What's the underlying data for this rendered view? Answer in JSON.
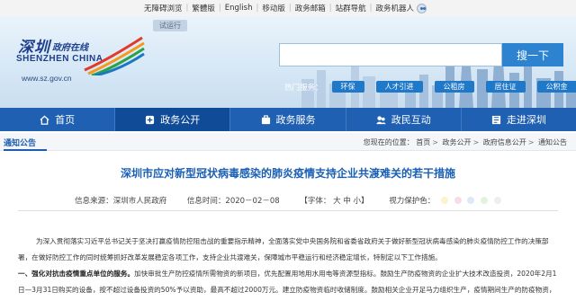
{
  "topbar": {
    "links": [
      "无障碍浏览",
      "繁體版",
      "English",
      "移动版",
      "政务邮箱",
      "站群导航",
      "政务机器人"
    ]
  },
  "header": {
    "logo_cn": "深圳",
    "logo_cn_small": "政府在线",
    "logo_en": "SHENZHEN CHINA",
    "trial_tag": "试运行",
    "url": "www.sz.gov.cn",
    "search_placeholder": "",
    "search_button": "搜一下",
    "hot_label": "热门服务：",
    "hot_tags": [
      "环保",
      "人才引进",
      "公租房",
      "居住证",
      "公积金"
    ]
  },
  "nav": [
    {
      "label": "首页",
      "icon": "home-icon"
    },
    {
      "label": "政务公开",
      "icon": "open-gov-icon"
    },
    {
      "label": "政务服务",
      "icon": "service-icon"
    },
    {
      "label": "政民互动",
      "icon": "interaction-icon"
    },
    {
      "label": "走进深圳",
      "icon": "explore-icon"
    }
  ],
  "breadcrumb": {
    "current": "通知公告",
    "path": [
      "您现在的位置：",
      "首页",
      "政务公开",
      "政府信息公开",
      "通知公告"
    ]
  },
  "article": {
    "title": "深圳市应对新型冠状病毒感染的肺炎疫情支持企业共渡难关的若干措施",
    "source_label": "信息来源：",
    "source": "深圳市人民政府",
    "date_label": "信息时间：",
    "date": "2020－02－08",
    "font_label": "【字体：",
    "font_sizes": [
      "大",
      "中",
      "小"
    ],
    "font_close": "】",
    "vision_label": "视力保护色：",
    "vision_colors": [
      "#fdf3c8",
      "#f7dce6",
      "#dde9f9",
      "#e2f3dd",
      "#eeeeee"
    ],
    "para1": "为深入贯彻落实习近平总书记关于坚决打赢疫情防控阻击战的重要指示精神，全面落实党中央国务院和省委省政府关于做好新型冠状病毒感染的肺炎疫情防控工作的决策部署，在做好防控工作的同时统筹抓好改革发展稳定各项工作，支持企业共渡难关，保障城市平稳运行和经济稳定增长，特制定以下工作措施。",
    "para2_bold": "一、强化对抗击疫情重点单位的服务。",
    "para2": "加快审批生产防控疫情所需物资的新项目，优先配置用地用水用电等资源型指标。鼓励生产防疫物资的企业扩大技术改造投资，2020年2月1日—3月31日购买的设备，按不超过设备投资的50%予以资助，最高不超过2000万元。建立防疫物资临时收储制度。鼓励相关企业开足马力组织生产，疫情期间生产的防疫物资，在"
  }
}
